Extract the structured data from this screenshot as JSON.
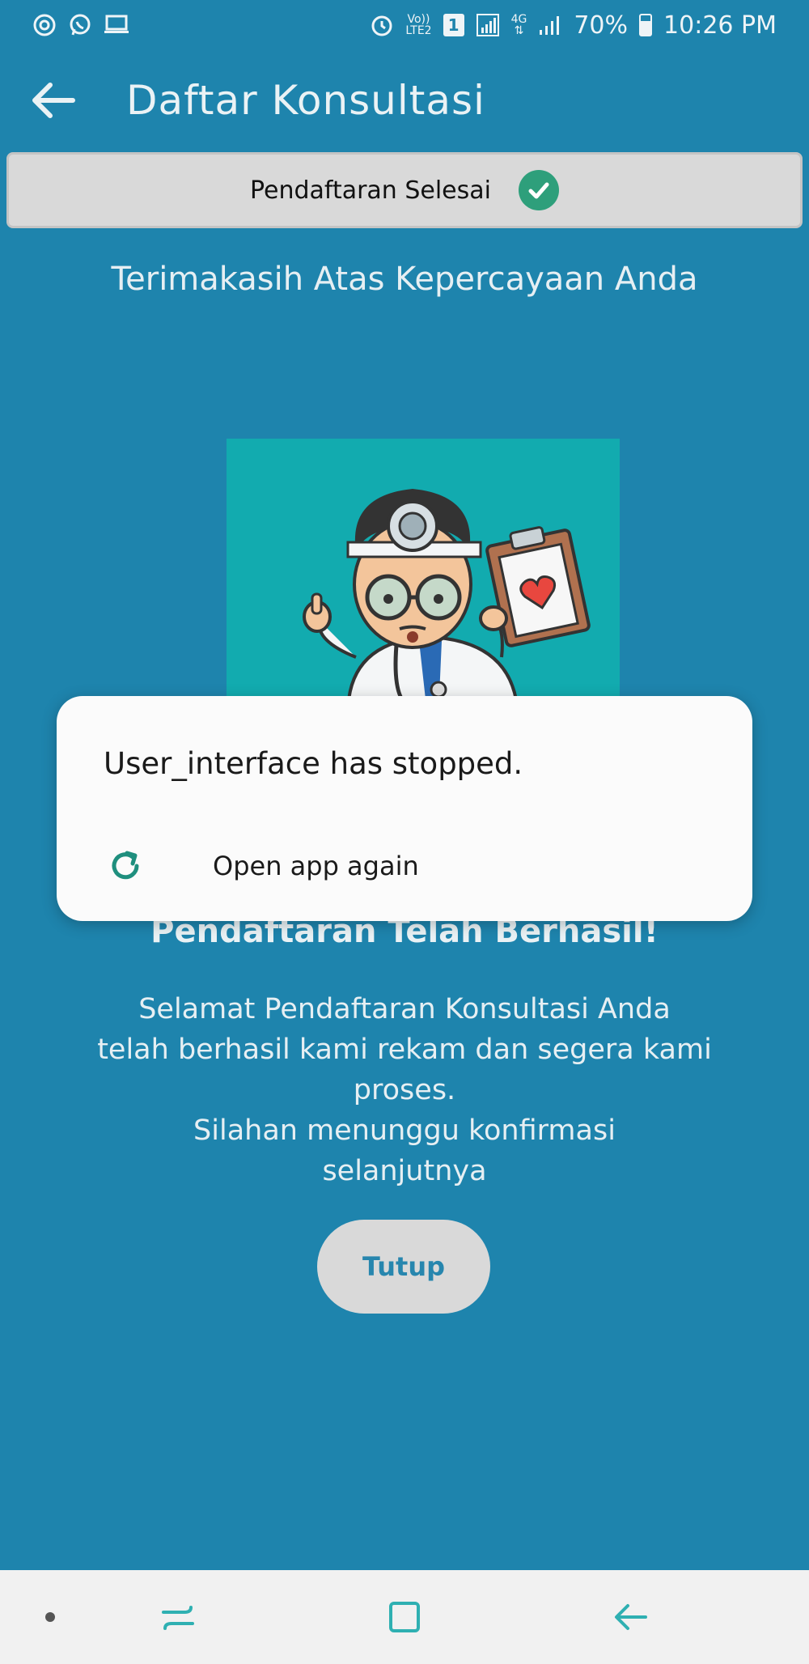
{
  "status_bar": {
    "left_icons": [
      "sync-icon",
      "whatsapp-icon",
      "screen-icon"
    ],
    "alarm_icon": "alarm-icon",
    "volte_top": "Vo))",
    "volte_bottom": "LTE2",
    "sim_number": "1",
    "network_top": "4G",
    "battery_percent": "70%",
    "battery_level": 0.7,
    "time": "10:26 PM"
  },
  "app_bar": {
    "back_icon": "arrow-left-icon",
    "title": "Daftar Konsultasi"
  },
  "banner": {
    "label": "Pendaftaran Selesai",
    "icon": "check-circle-icon",
    "icon_color": "#2e9f7b"
  },
  "thanks_text": "Terimakasih Atas Kepercayaan Anda",
  "success": {
    "title": "Pendaftaran Telah Berhasil!",
    "body": "Selamat Pendaftaran Konsultasi Anda\ntelah berhasil kami rekam dan segera kami\nproses.\nSilahan menunggu konfirmasi\nselanjutnya"
  },
  "close_button_label": "Tutup",
  "crash_dialog": {
    "message": "User_interface has stopped.",
    "reopen_label": "Open app again",
    "reopen_icon": "refresh-icon",
    "accent": "#1f8f7e"
  },
  "nav_bar": {
    "items": [
      "nav-dot-icon",
      "recent-apps-icon",
      "home-icon",
      "back-icon"
    ],
    "icon_color": "#2fb0b2"
  },
  "colors": {
    "background": "#1e84ad",
    "illustration_bg": "#12abaf"
  }
}
